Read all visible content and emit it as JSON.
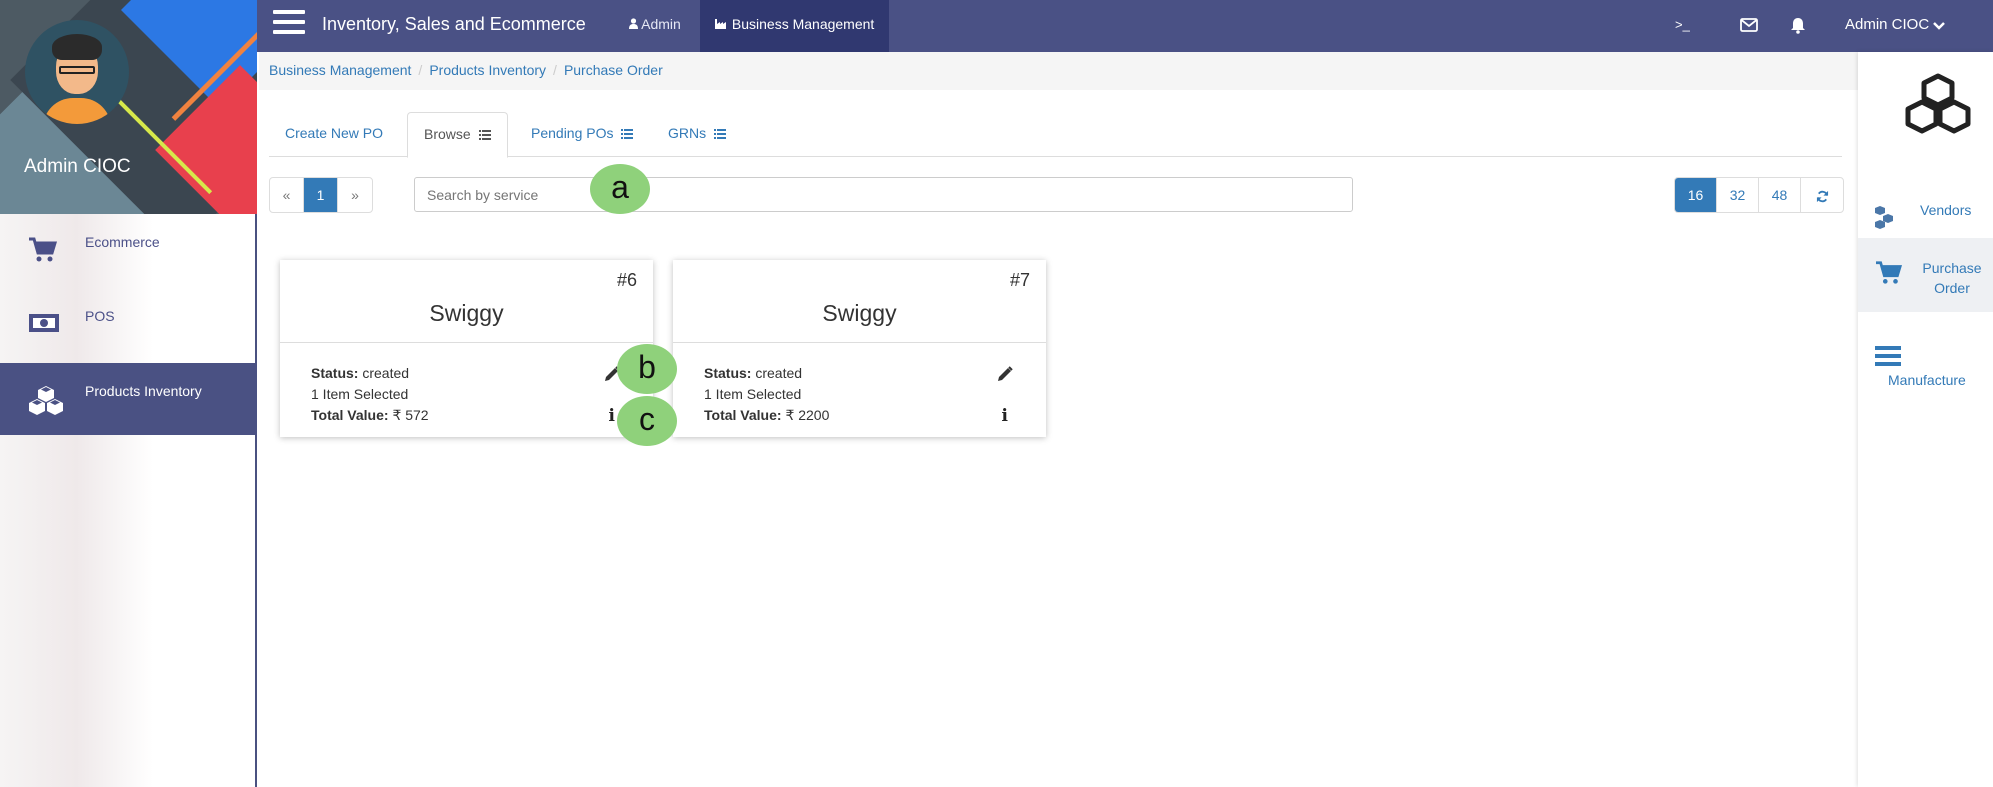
{
  "sidebar": {
    "profile_name": "Admin CIOC",
    "items": [
      {
        "label": "Ecommerce",
        "icon": "cart-icon"
      },
      {
        "label": "POS",
        "icon": "money-icon"
      },
      {
        "label": "Products Inventory",
        "icon": "cubes-icon",
        "active": true
      }
    ]
  },
  "navbar": {
    "title": "Inventory, Sales and Ecommerce",
    "links": [
      {
        "label": "Admin",
        "icon": "user-icon"
      },
      {
        "label": "Business Management",
        "icon": "industry-icon",
        "active": true
      }
    ],
    "terminal": ">_",
    "user": "Admin CIOC"
  },
  "breadcrumb": [
    "Business Management",
    "Products Inventory",
    "Purchase Order"
  ],
  "tabs": [
    {
      "label": "Create New PO"
    },
    {
      "label": "Browse",
      "active": true
    },
    {
      "label": "Pending POs"
    },
    {
      "label": "GRNs"
    }
  ],
  "pager": {
    "prev": "«",
    "current": "1",
    "next": "»"
  },
  "search": {
    "placeholder": "Search by service"
  },
  "page_sizes": [
    "16",
    "32",
    "48"
  ],
  "cards": [
    {
      "number": "#6",
      "name": "Swiggy",
      "status_label": "Status:",
      "status": "created",
      "items": "1 Item Selected",
      "total_label": "Total Value:",
      "total": "₹ 572"
    },
    {
      "number": "#7",
      "name": "Swiggy",
      "status_label": "Status:",
      "status": "created",
      "items": "1 Item Selected",
      "total_label": "Total Value:",
      "total": "₹ 2200"
    }
  ],
  "annotations": [
    "a",
    "b",
    "c"
  ],
  "right_panel": {
    "items": [
      {
        "label": "Vendors",
        "icon": "vendors-icon"
      },
      {
        "label": "Purchase Order",
        "icon": "cart-icon",
        "active": true
      },
      {
        "label": "Manufacture",
        "icon": "list-icon"
      }
    ]
  },
  "colors": {
    "nav": "#4a5185",
    "nav_active": "#303870",
    "link": "#337ab7",
    "annotation": "#8fd17b"
  }
}
